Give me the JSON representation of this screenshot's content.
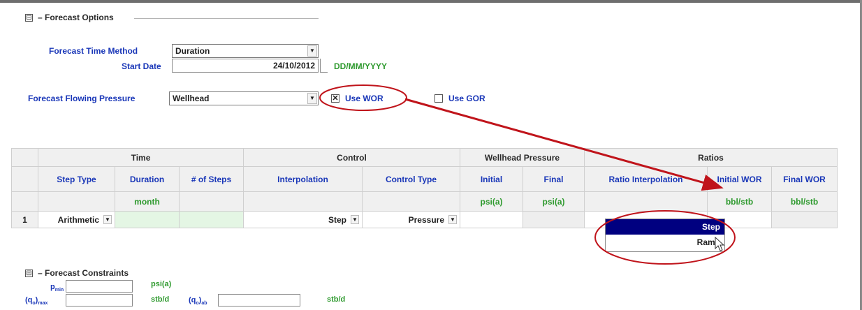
{
  "forecast_options": {
    "title": "Forecast Options",
    "collapse_glyph": "⊟",
    "time_method_label": "Forecast Time Method",
    "time_method_value": "Duration",
    "start_date_label": "Start Date",
    "start_date_value": "24/10/2012",
    "date_format_hint": "DD/MM/YYYY",
    "flowing_pressure_label": "Forecast Flowing Pressure",
    "flowing_pressure_value": "Wellhead",
    "use_wor_label": "Use WOR",
    "use_wor_checked": true,
    "use_gor_label": "Use GOR",
    "use_gor_checked": false
  },
  "grid": {
    "group_headers": {
      "time": "Time",
      "control": "Control",
      "wellhead_pressure": "Wellhead Pressure",
      "ratios": "Ratios"
    },
    "column_headers": {
      "step_type": "Step Type",
      "duration": "Duration",
      "num_steps": "# of Steps",
      "interpolation": "Interpolation",
      "control_type": "Control Type",
      "initial": "Initial",
      "final": "Final",
      "ratio_interpolation": "Ratio Interpolation",
      "initial_wor": "Initial WOR",
      "final_wor": "Final WOR"
    },
    "units": {
      "duration": "month",
      "initial": "psi(a)",
      "final": "psi(a)",
      "initial_wor": "bbl/stb",
      "final_wor": "bbl/stb"
    },
    "rows": [
      {
        "index": "1",
        "step_type": "Arithmetic",
        "interpolation": "Step",
        "control_type": "Pressure"
      }
    ]
  },
  "ratio_dropdown": {
    "options": [
      "Step",
      "Ramp"
    ],
    "selected": "Step"
  },
  "forecast_constraints": {
    "title": "Forecast Constraints",
    "collapse_glyph": "⊟",
    "pmin_label": "p",
    "pmin_sub": "min",
    "pmin_unit": "psi(a)",
    "qo_max_label": "(q",
    "qo_max_sub": "o",
    "qo_max_tail": ")",
    "qo_max_sub2": "max",
    "qo_max_unit": "stb/d",
    "qo_ab_label": "(q",
    "qo_ab_sub": "o",
    "qo_ab_tail": ")",
    "qo_ab_sub2": "ab",
    "qo_ab_unit": "stb/d"
  },
  "annotation": {
    "ellipse_color": "#c0141b",
    "arrow_color": "#c0141b"
  }
}
